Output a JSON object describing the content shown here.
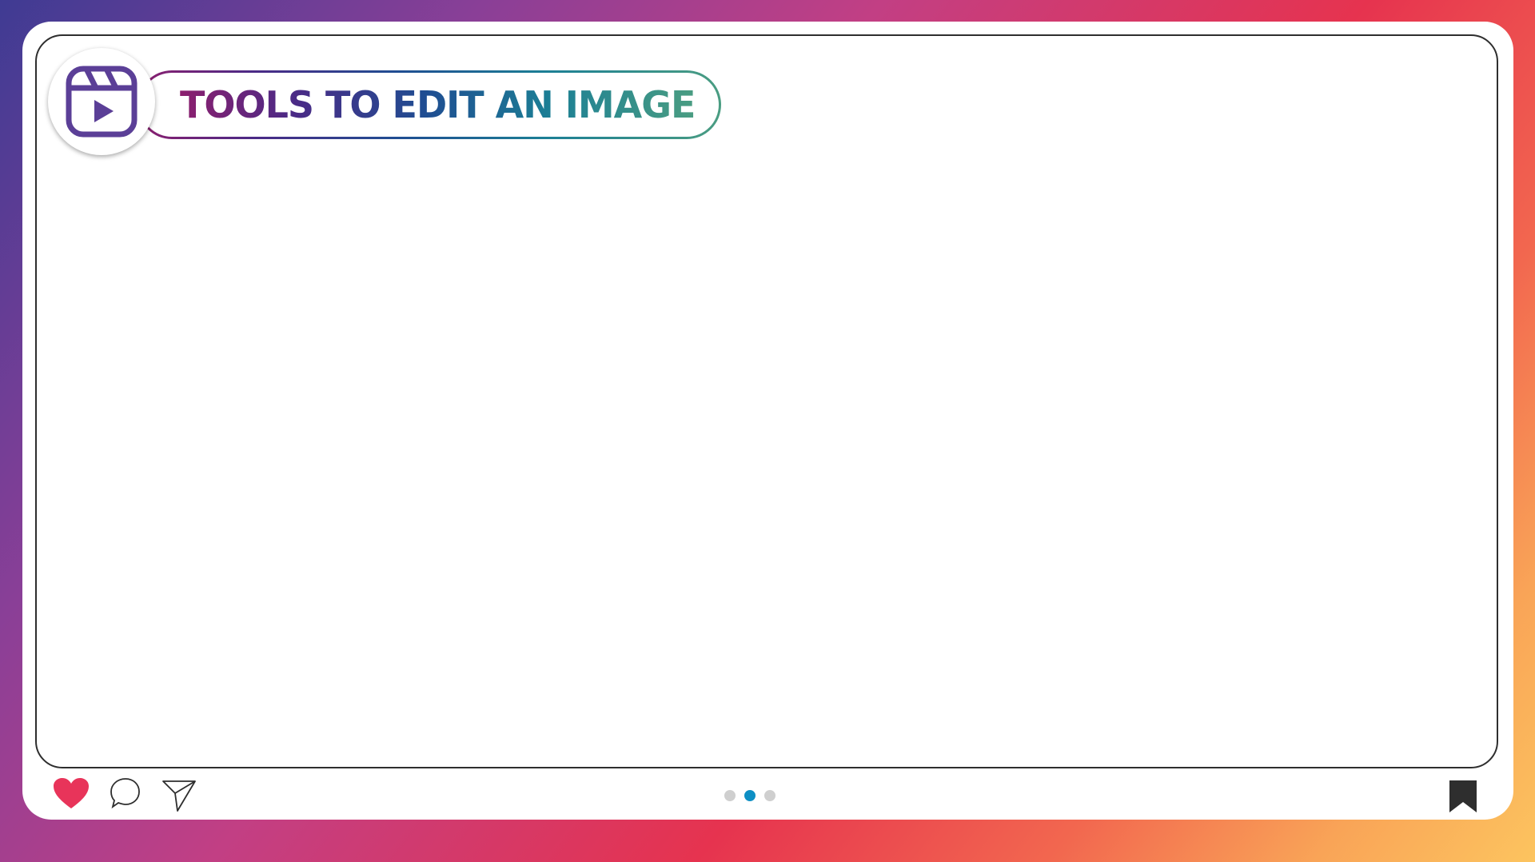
{
  "header": {
    "title": "TOOLS TO EDIT AN IMAGE",
    "icon": "reels-icon"
  },
  "actions": {
    "like_icon": "heart-icon",
    "comment_icon": "comment-icon",
    "share_icon": "send-icon",
    "save_icon": "bookmark-icon"
  },
  "carousel": {
    "total": 3,
    "active_index": 1
  },
  "colors": {
    "heart": "#e8345a",
    "active_dot": "#0e8fc4",
    "inactive_dot": "#cfcfcf",
    "reel_icon": "#5b3f97"
  }
}
